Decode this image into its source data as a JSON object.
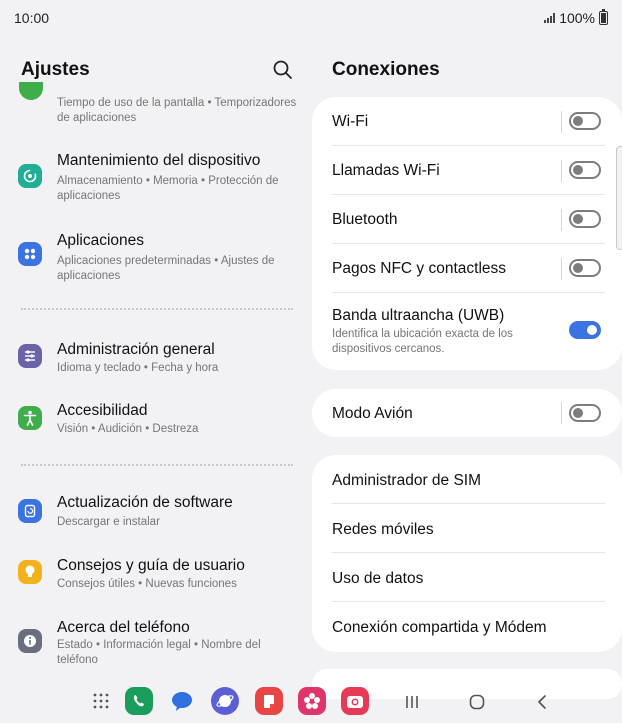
{
  "status_bar": {
    "time": "10:00",
    "battery": "100%"
  },
  "left_pane": {
    "title": "Ajustes",
    "partial_item": {
      "subtitle": "Tiempo de uso de la pantalla  •  Temporizadores de aplicaciones"
    },
    "items": [
      {
        "title": "Mantenimiento del dispositivo",
        "subtitle": "Almacenamiento  •  Memoria  •  Protección de aplicaciones",
        "icon": "device-care-icon",
        "color": "#1fae96"
      },
      {
        "title": "Aplicaciones",
        "subtitle": "Aplicaciones predeterminadas  •  Ajustes de aplicaciones",
        "icon": "apps-icon",
        "color": "#3b73e3"
      },
      {
        "title": "Administración general",
        "subtitle": "Idioma y teclado  •  Fecha y hora",
        "icon": "sliders-icon",
        "color": "#6a63a8"
      },
      {
        "title": "Accesibilidad",
        "subtitle": "Visión  •  Audición  •  Destreza",
        "icon": "accessibility-icon",
        "color": "#3fae4a"
      },
      {
        "title": "Actualización de software",
        "subtitle": "Descargar e instalar",
        "icon": "software-update-icon",
        "color": "#3b73e3"
      },
      {
        "title": "Consejos y guía de usuario",
        "subtitle": "Consejos útiles  •  Nuevas funciones",
        "icon": "lightbulb-icon",
        "color": "#f2b21e"
      },
      {
        "title": "Acerca del teléfono",
        "subtitle": "Estado  •  Información legal  •  Nombre del teléfono",
        "icon": "info-icon",
        "color": "#6a6f80"
      }
    ]
  },
  "right_pane": {
    "title": "Conexiones",
    "card1": [
      {
        "label": "Wi-Fi",
        "toggle": false
      },
      {
        "label": "Llamadas Wi-Fi",
        "toggle": false
      },
      {
        "label": "Bluetooth",
        "toggle": false
      },
      {
        "label": "Pagos NFC y contactless",
        "toggle": false
      },
      {
        "label": "Banda ultraancha (UWB)",
        "subtitle": "Identifica la ubicación exacta de los dispositivos cercanos.",
        "toggle": true
      }
    ],
    "card2": [
      {
        "label": "Modo Avión",
        "toggle": false
      }
    ],
    "card3": [
      {
        "label": "Administrador de SIM"
      },
      {
        "label": "Redes móviles"
      },
      {
        "label": "Uso de datos"
      },
      {
        "label": "Conexión compartida y Módem"
      }
    ]
  },
  "navbar": {
    "apps": [
      {
        "name": "app-drawer-icon",
        "color": "#555555"
      },
      {
        "name": "phone-app-icon",
        "color": "#1a9c5b"
      },
      {
        "name": "messages-app-icon",
        "color": "#2f6fe0"
      },
      {
        "name": "internet-app-icon",
        "color": "#5b5fd6"
      },
      {
        "name": "notes-app-icon",
        "color": "#e84545"
      },
      {
        "name": "gallery-app-icon",
        "color": "#e0356b"
      },
      {
        "name": "camera-app-icon",
        "color": "#e63a55"
      }
    ]
  },
  "accent_color": "#3b73e3"
}
